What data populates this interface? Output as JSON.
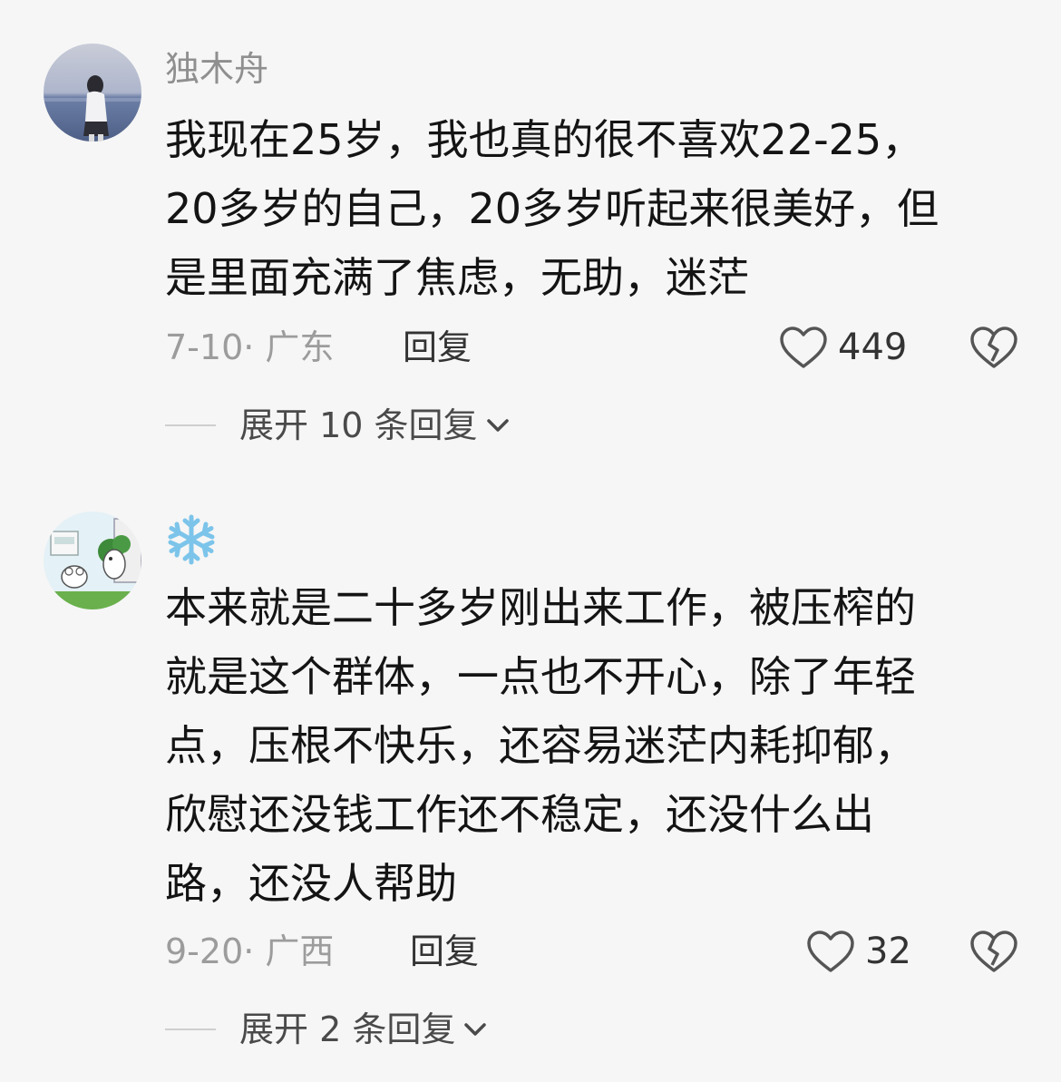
{
  "comments": [
    {
      "username": "独木舟",
      "text_lines": [
        "我现在25岁，我也真的很不喜欢22-25，",
        "20多岁的自己，20多岁听起来很美好，但",
        "是里面充满了焦虑，无助，迷茫"
      ],
      "date_location": "7-10· 广东",
      "reply_label": "回复",
      "likes": "449",
      "expand_label": "展开 10 条回复"
    },
    {
      "username_icon": "snowflake-icon",
      "text_lines": [
        "本来就是二十多岁刚出来工作，被压榨的",
        "就是这个群体，一点也不开心，除了年轻",
        "点，压根不快乐，还容易迷茫内耗抑郁，",
        "欣慰还没钱工作还不稳定，还没什么出",
        "路，还没人帮助"
      ],
      "date_location": "9-20· 广西",
      "reply_label": "回复",
      "likes": "32",
      "expand_label": "展开 2 条回复"
    }
  ]
}
